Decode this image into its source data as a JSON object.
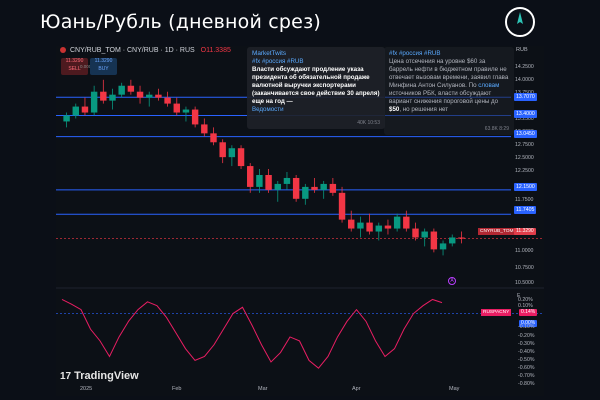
{
  "header": {
    "title": "Юань/Рубль (дневной срез)",
    "logo": "compass-needle-icon"
  },
  "symbol": {
    "name": "CNY/RUB_TOM · CNY/RUB · 1D · RUS",
    "ohlc": "O11.3385",
    "sell_price": "11.3290",
    "sell_label": "SELL",
    "spread": "0.0000",
    "buy_price": "11.3290",
    "buy_label": "BUY"
  },
  "news_left": {
    "channel": "MarketTwits",
    "tags": "#fx #россия #RUB",
    "text": "Власти обсуждают продление указа президента об обязательной продаже валютной выручки экспортерами (заканчивается свое действие 30 апреля) еще на год —",
    "source": "Ведомости",
    "views": "40K",
    "time": "10:53"
  },
  "news_right": {
    "tags": "#fx #россия #RUB",
    "text1": "Цена отсечения на уровне $60 за баррель нефти в бюджетном правиле не отвечает вызовам времени, заявил глава Минфина Антон Силуанов. По",
    "link": "словам",
    "text2": "источников РБК, власти обсуждают вариант снижения пороговой цены до",
    "highlight": "$50",
    "text3": ", но решения нет",
    "views": "63.8K",
    "time": "8:29"
  },
  "price_axis": {
    "currency": "RUB",
    "ticks": [
      "14.2500",
      "14.0000",
      "13.7500",
      "13.2500",
      "13.0000",
      "12.7500",
      "12.5000",
      "12.2500",
      "11.7500",
      "11.5000",
      "11.0000",
      "10.7500",
      "10.5000"
    ],
    "badges": [
      {
        "label": "13.7070",
        "color": "#2962ff"
      },
      {
        "label": "13.4000",
        "color": "#2962ff"
      },
      {
        "label": "13.0450",
        "color": "#2962ff"
      },
      {
        "label": "12.1500",
        "color": "#2962ff"
      },
      {
        "label": "11.7405",
        "color": "#2962ff"
      }
    ],
    "current_label": "CNYRUB_TOM",
    "current_price": "11.3290"
  },
  "oscillator": {
    "label": "RUSPACNY",
    "value": "0.14%",
    "zero": "0.00%",
    "ticks": [
      "0.20%",
      "0.10%",
      "-0.10%",
      "-0.20%",
      "-0.30%",
      "-0.40%",
      "-0.50%",
      "-0.60%",
      "-0.70%",
      "-0.80%"
    ],
    "scale_label": "E",
    "marker": "A"
  },
  "x_axis": {
    "labels": [
      "2025",
      "Feb",
      "Mar",
      "Apr",
      "May"
    ]
  },
  "branding": {
    "logo_text": "TradingView",
    "logo_mark": "17"
  },
  "chart_data": {
    "type": "candlestick",
    "ylim": [
      10.4,
      14.4
    ],
    "candles": [
      [
        13.3,
        13.45,
        13.2,
        13.4
      ],
      [
        13.4,
        13.6,
        13.35,
        13.55
      ],
      [
        13.55,
        13.7,
        13.4,
        13.45
      ],
      [
        13.45,
        13.9,
        13.4,
        13.8
      ],
      [
        13.8,
        14.0,
        13.6,
        13.65
      ],
      [
        13.65,
        13.85,
        13.5,
        13.75
      ],
      [
        13.75,
        13.95,
        13.7,
        13.9
      ],
      [
        13.9,
        14.0,
        13.75,
        13.8
      ],
      [
        13.8,
        13.9,
        13.6,
        13.7
      ],
      [
        13.7,
        13.8,
        13.55,
        13.75
      ],
      [
        13.75,
        13.85,
        13.65,
        13.7
      ],
      [
        13.7,
        13.8,
        13.55,
        13.6
      ],
      [
        13.6,
        13.7,
        13.4,
        13.45
      ],
      [
        13.45,
        13.55,
        13.3,
        13.5
      ],
      [
        13.5,
        13.55,
        13.2,
        13.25
      ],
      [
        13.25,
        13.35,
        13.05,
        13.1
      ],
      [
        13.1,
        13.2,
        12.9,
        12.95
      ],
      [
        12.95,
        13.0,
        12.6,
        12.7
      ],
      [
        12.7,
        12.9,
        12.55,
        12.85
      ],
      [
        12.85,
        12.9,
        12.5,
        12.55
      ],
      [
        12.55,
        12.6,
        12.1,
        12.2
      ],
      [
        12.2,
        12.5,
        12.1,
        12.4
      ],
      [
        12.4,
        12.5,
        12.1,
        12.15
      ],
      [
        12.15,
        12.3,
        11.95,
        12.25
      ],
      [
        12.25,
        12.45,
        12.15,
        12.35
      ],
      [
        12.35,
        12.4,
        11.95,
        12.0
      ],
      [
        12.0,
        12.25,
        11.9,
        12.2
      ],
      [
        12.2,
        12.35,
        12.1,
        12.15
      ],
      [
        12.15,
        12.3,
        12.0,
        12.25
      ],
      [
        12.25,
        12.35,
        12.05,
        12.1
      ],
      [
        12.1,
        12.2,
        11.6,
        11.65
      ],
      [
        11.65,
        11.8,
        11.45,
        11.5
      ],
      [
        11.5,
        11.7,
        11.35,
        11.6
      ],
      [
        11.6,
        11.75,
        11.4,
        11.45
      ],
      [
        11.45,
        11.6,
        11.3,
        11.55
      ],
      [
        11.55,
        11.65,
        11.4,
        11.5
      ],
      [
        11.5,
        11.75,
        11.45,
        11.7
      ],
      [
        11.7,
        11.8,
        11.45,
        11.5
      ],
      [
        11.5,
        11.6,
        11.3,
        11.35
      ],
      [
        11.35,
        11.5,
        11.2,
        11.45
      ],
      [
        11.45,
        11.5,
        11.1,
        11.15
      ],
      [
        11.15,
        11.3,
        11.05,
        11.25
      ],
      [
        11.25,
        11.4,
        11.2,
        11.35
      ],
      [
        11.35,
        11.45,
        11.25,
        11.33
      ]
    ],
    "oscillator_series": [
      0.18,
      0.12,
      0.05,
      -0.2,
      -0.35,
      -0.55,
      -0.3,
      -0.1,
      0.05,
      0.15,
      0.1,
      -0.05,
      -0.25,
      -0.45,
      -0.6,
      -0.55,
      -0.4,
      -0.2,
      0.0,
      0.08,
      -0.15,
      -0.4,
      -0.62,
      -0.5,
      -0.3,
      -0.35,
      -0.6,
      -0.7,
      -0.55,
      -0.3,
      -0.1,
      0.05,
      -0.1,
      -0.35,
      -0.55,
      -0.45,
      -0.2,
      0.0,
      0.1,
      0.18,
      0.14
    ]
  }
}
